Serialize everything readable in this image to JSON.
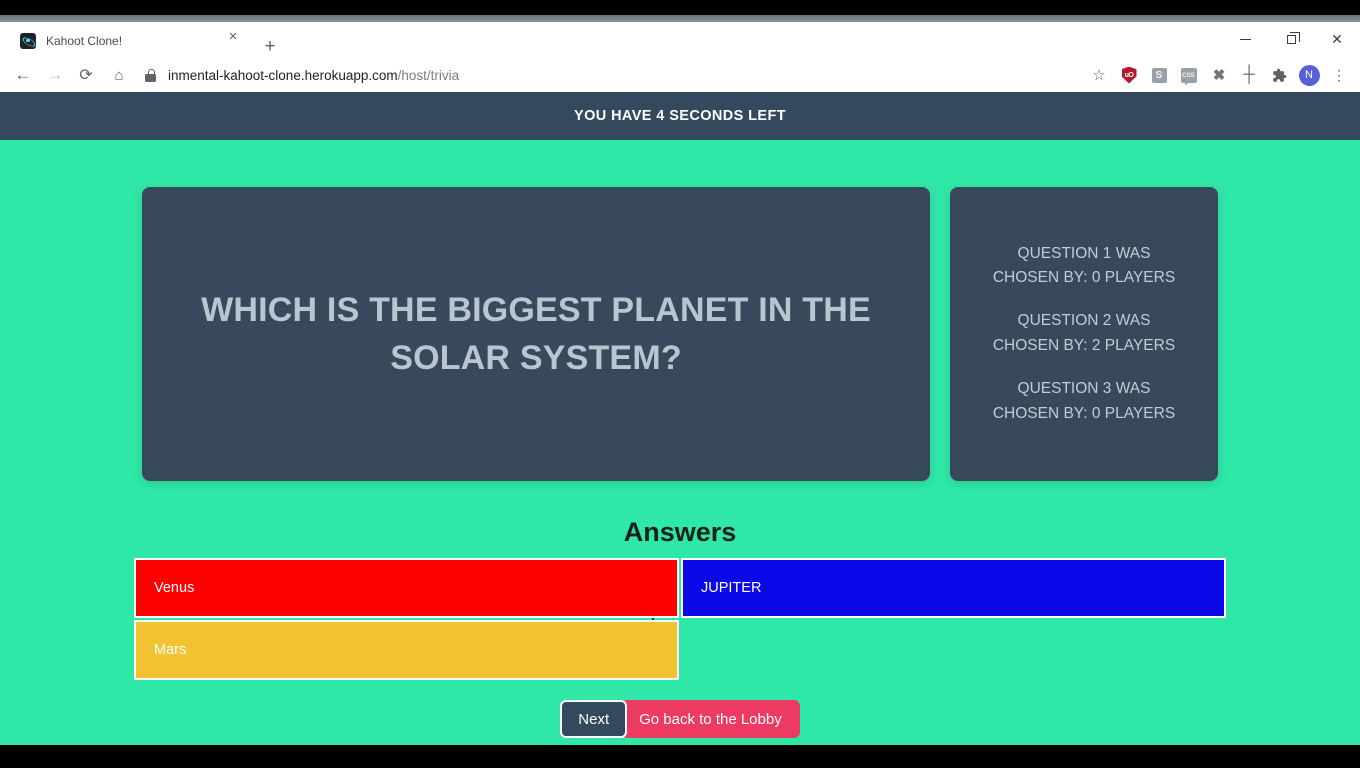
{
  "browser": {
    "tab": {
      "title": "Kahoot Clone!",
      "favicon": "react-atom-icon",
      "close_label": "×"
    },
    "new_tab_label": "+",
    "window_controls": {
      "minimize": "minimize-icon",
      "maximize": "restore-icon",
      "close": "✕"
    },
    "nav": {
      "back": "←",
      "forward": "→",
      "reload": "⟳",
      "home": "⌂"
    },
    "address": {
      "lock": "lock-icon",
      "host": "inmental-kahoot-clone.herokuapp.com",
      "path": "/host/trivia"
    },
    "toolbar_icons": [
      {
        "name": "bookmark-star-icon",
        "glyph": "☆"
      },
      {
        "name": "ublock-origin-icon",
        "glyph": "uO"
      },
      {
        "name": "stylus-extension-icon",
        "glyph": "S"
      },
      {
        "name": "css-extension-icon",
        "glyph": "CSS"
      },
      {
        "name": "scissors-extension-icon",
        "glyph": "✖"
      },
      {
        "name": "move-crosshair-icon",
        "glyph": "┼"
      },
      {
        "name": "extensions-puzzle-icon",
        "glyph": "🧩"
      },
      {
        "name": "profile-avatar",
        "glyph": "N"
      },
      {
        "name": "chrome-menu-icon",
        "glyph": "⋮"
      }
    ]
  },
  "page": {
    "timer_banner": "YOU HAVE 4 SECONDS LEFT",
    "question": "WHICH IS THE BIGGEST PLANET IN THE SOLAR SYSTEM?",
    "stats": [
      "QUESTION 1 WAS CHOSEN BY: 0 PLAYERS",
      "QUESTION 2 WAS CHOSEN BY: 2 PLAYERS",
      "QUESTION 3 WAS CHOSEN BY: 0 PLAYERS"
    ],
    "stats_lines": [
      {
        "line1": "QUESTION 1 WAS",
        "line2": "CHOSEN BY: 0 PLAYERS"
      },
      {
        "line1": "QUESTION 2 WAS",
        "line2": "CHOSEN BY: 2 PLAYERS"
      },
      {
        "line1": "QUESTION 3 WAS",
        "line2": "CHOSEN BY: 0 PLAYERS"
      }
    ],
    "answers_heading": "Answers",
    "answers": [
      {
        "label": "Venus",
        "color": "#fd0000"
      },
      {
        "label": "JUPITER",
        "color": "#0b08e8"
      },
      {
        "label": "Mars",
        "color": "#f2c230"
      }
    ],
    "buttons": {
      "next": "Next",
      "lobby": "Go back to the Lobby"
    },
    "colors": {
      "background": "#2fe8a8",
      "card": "#38495c",
      "banner": "#34495e",
      "lobby_button": "#ec3a63",
      "question_text": "#b9c6cf"
    }
  }
}
